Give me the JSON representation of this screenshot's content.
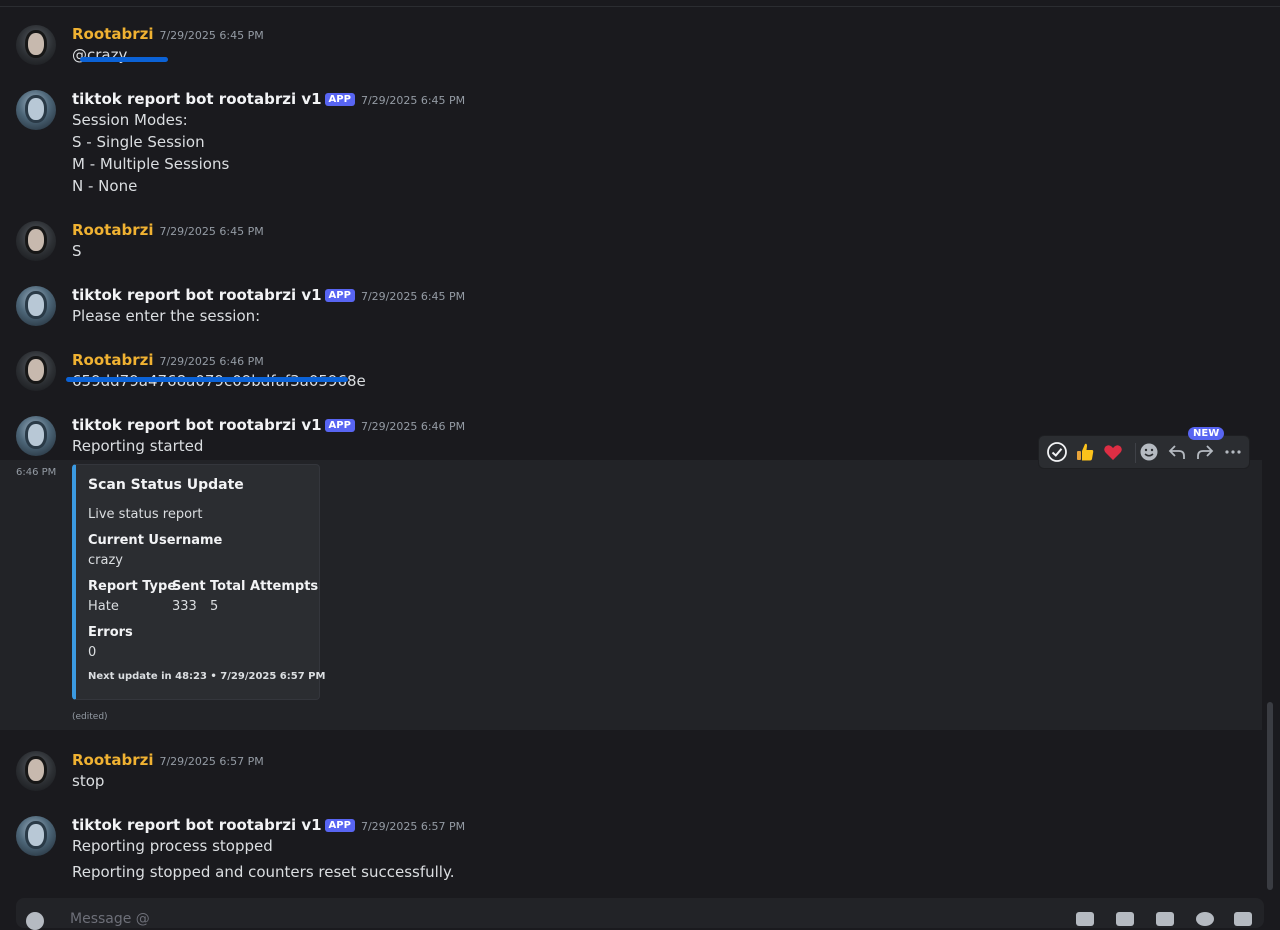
{
  "users": {
    "human": "Rootabrzi",
    "bot": "tiktok report bot rootabrzi v1",
    "app_tag": "APP"
  },
  "messages": [
    {
      "ts": "7/29/2025 6:45 PM",
      "lines": [
        "@crazy"
      ]
    },
    {
      "ts": "7/29/2025 6:45 PM",
      "lines": [
        "Session Modes:",
        "S - Single Session",
        "M - Multiple Sessions",
        "N - None"
      ]
    },
    {
      "ts": "7/29/2025 6:45 PM",
      "lines": [
        "S"
      ]
    },
    {
      "ts": "7/29/2025 6:45 PM",
      "lines": [
        "Please enter the session:"
      ]
    },
    {
      "ts": "7/29/2025 6:46 PM",
      "lines": [
        "659dd79a4768a079c09bdfaf3a05968e"
      ]
    },
    {
      "ts": "7/29/2025 6:46 PM",
      "lines": [
        "Reporting started"
      ]
    },
    {
      "ts": "7/29/2025 6:57 PM",
      "lines": [
        "stop"
      ]
    },
    {
      "ts": "7/29/2025 6:57 PM",
      "lines": [
        "Reporting process stopped",
        "Reporting stopped and counters reset successfully."
      ]
    }
  ],
  "embed": {
    "side_time": "6:46 PM",
    "title": "Scan Status Update",
    "description": "Live status report",
    "current_username_label": "Current Username",
    "current_username_value": "crazy",
    "report_type_label": "Report Type",
    "report_type_value": "Hate",
    "sent_label": "Sent",
    "sent_value": "333",
    "total_attempts_label": "Total Attempts",
    "total_attempts_value": "5",
    "errors_label": "Errors",
    "errors_value": "0",
    "footer": "Next update in 48:23 • 7/29/2025 6:57 PM",
    "edited": "(edited)",
    "accent_color": "#3b9ae1"
  },
  "toolbar": {
    "new_badge": "NEW",
    "icons": [
      "check-reaction-icon",
      "thumbs-up-reaction-icon",
      "heart-reaction-icon",
      "add-reaction-icon",
      "reply-icon",
      "forward-icon",
      "more-icon"
    ]
  },
  "composer": {
    "placeholder": "Message @"
  },
  "colors": {
    "background": "#1a1a1e",
    "human_name": "#f0b232",
    "app_tag": "#5865f2"
  }
}
